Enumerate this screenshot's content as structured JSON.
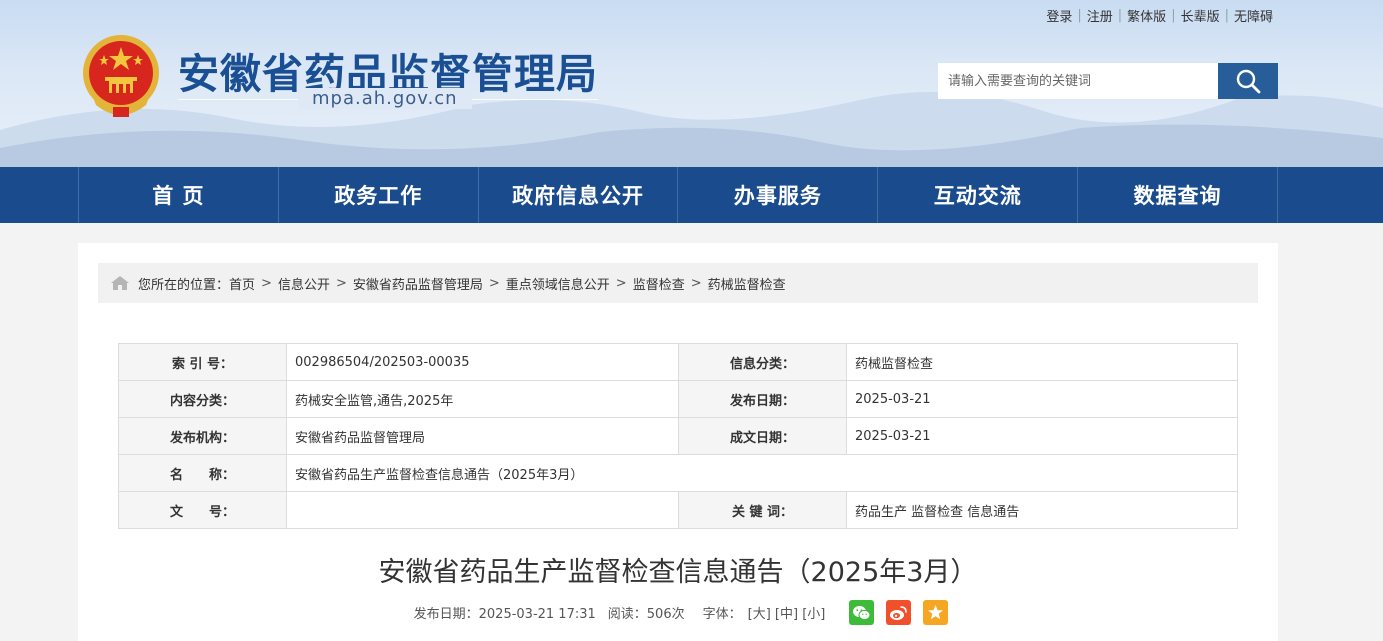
{
  "header": {
    "site_title": "安徽省药品监督管理局",
    "site_domain": "mpa.ah.gov.cn",
    "top_links": [
      "登录",
      "注册",
      "繁体版",
      "长辈版",
      "无障碍"
    ],
    "search_placeholder": "请输入需要查询的关键词"
  },
  "nav": {
    "items": [
      "首 页",
      "政务工作",
      "政府信息公开",
      "办事服务",
      "互动交流",
      "数据查询"
    ]
  },
  "breadcrumb": {
    "prefix": "您所在的位置：",
    "items": [
      "首页",
      "信息公开",
      "安徽省药品监督管理局",
      "重点领域信息公开",
      "监督检查",
      "药械监督检查"
    ],
    "separator": ">"
  },
  "meta": {
    "index_label": "索 引 号：",
    "index_value": "002986504/202503-00035",
    "category_label": "信息分类：",
    "category_value": "药械监督检查",
    "content_label": "内容分类：",
    "content_value": "药械安全监管,通告,2025年",
    "publish_date_label": "发布日期：",
    "publish_date_value": "2025-03-21",
    "org_label": "发布机构：",
    "org_value": "安徽省药品监督管理局",
    "created_label": "成文日期：",
    "created_value": "2025-03-21",
    "name_label": "名　　称：",
    "name_value": "安徽省药品生产监督检查信息通告（2025年3月）",
    "doc_no_label": "文　　号：",
    "doc_no_value": "",
    "keywords_label": "关 键 词：",
    "keywords_value": "药品生产 监督检查 信息通告"
  },
  "article": {
    "title": "安徽省药品生产监督检查信息通告（2025年3月）",
    "publish_info": "发布日期：2025-03-21 17:31",
    "views": "阅读：506次",
    "font_label": "字体：",
    "font_large": "[大]",
    "font_medium": "[中]",
    "font_small": "[小]"
  },
  "colors": {
    "nav_bg": "#1a4b8c",
    "title_blue": "#1b4f93",
    "wechat": "#3fbb3a",
    "weibo": "#f0502b",
    "favorite": "#f5a623"
  },
  "icons": {
    "search": "search-icon",
    "home": "home-icon",
    "share": [
      "wechat-icon",
      "weibo-icon",
      "star-icon"
    ]
  }
}
